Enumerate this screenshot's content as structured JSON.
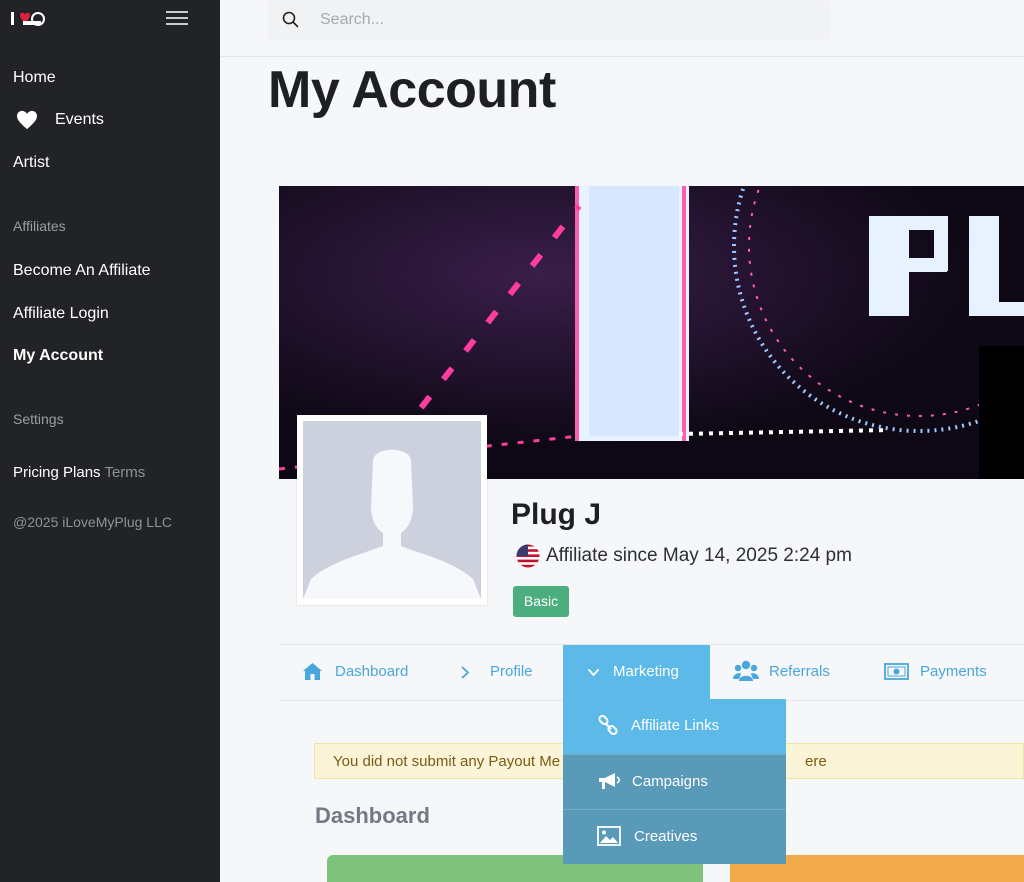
{
  "sidebar": {
    "logo_text": "ILMP",
    "nav": {
      "home": "Home",
      "events": "Events",
      "artist": "Artist"
    },
    "affiliates_heading": "Affiliates",
    "affiliates": {
      "become": "Become An Affiliate",
      "login": "Affiliate Login",
      "account": "My Account"
    },
    "settings_heading": "Settings",
    "pricing": "Pricing Plans",
    "terms": "Terms",
    "copyright": "@2025 iLoveMyPlug LLC"
  },
  "search": {
    "placeholder": "Search..."
  },
  "page": {
    "title": "My Account"
  },
  "profile": {
    "name": "Plug J",
    "since": "Affiliate since May 14, 2025 2:24 pm",
    "plan_badge": "Basic"
  },
  "tabs": {
    "dashboard": "Dashboard",
    "profile": "Profile",
    "marketing": "Marketing",
    "referrals": "Referrals",
    "payments": "Payments"
  },
  "marketing_menu": {
    "links": "Affiliate Links",
    "campaigns": "Campaigns",
    "creatives": "Creatives"
  },
  "alert": {
    "left_text": "You did not submit any Payout Me",
    "right_text": "ere"
  },
  "dashboard": {
    "title": "Dashboard"
  },
  "colors": {
    "sidebar_bg": "#212327",
    "accent": "#4aa7dd",
    "active_tab": "#5cb9e8",
    "badge": "#4cae7f",
    "alert_bg": "#fcf4d6"
  }
}
